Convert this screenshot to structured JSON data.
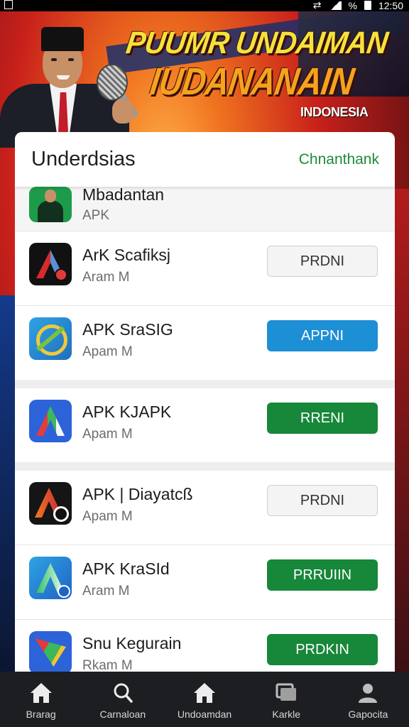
{
  "status_bar": {
    "time": "12:50",
    "battery_text": "%"
  },
  "banner": {
    "title_line1": "PUUMR UNDAIMAN",
    "title_line2": "IUDANANAIN",
    "subtitle": "INDONESIA"
  },
  "card": {
    "title": "Underdsias",
    "link": "Chnanthank"
  },
  "apps": [
    {
      "name": "Mbadantan",
      "sub": "APK",
      "button": "",
      "button_style": "none",
      "icon": "app-icon-person"
    },
    {
      "name": "ArK Scafiksj",
      "sub": "Aram M",
      "button": "PRDNI",
      "button_style": "gray",
      "icon": "app-icon-a-dark"
    },
    {
      "name": "APK SraSIG",
      "sub": "Apam M",
      "button": "APPNI",
      "button_style": "blue",
      "icon": "app-icon-ring"
    },
    {
      "name": "APK KJAPK",
      "sub": "Apam M",
      "button": "RRENI",
      "button_style": "green",
      "icon": "app-icon-a-blue"
    },
    {
      "name": "APK | Diayatcß",
      "sub": "Apam M",
      "button": "PRDNI",
      "button_style": "gray",
      "icon": "app-icon-a-orange"
    },
    {
      "name": "APK KraSId",
      "sub": "Aram M",
      "button": "PRRUIIN",
      "button_style": "green",
      "icon": "app-icon-a-green"
    },
    {
      "name": "Snu Kegurain",
      "sub": "Rkam M",
      "button": "PRDKIN",
      "button_style": "green",
      "icon": "app-icon-shape"
    }
  ],
  "nav": [
    {
      "label": "Brarag",
      "icon": "home-icon"
    },
    {
      "label": "Carnaloan",
      "icon": "search-icon"
    },
    {
      "label": "Undoamdan",
      "icon": "home-icon"
    },
    {
      "label": "Karkle",
      "icon": "library-icon"
    },
    {
      "label": "Gapocita",
      "icon": "profile-icon"
    }
  ],
  "colors": {
    "accent_green": "#17873a",
    "accent_blue": "#1d8fd5",
    "link_green": "#1e8b3a",
    "nav_bg": "#1d1e22"
  }
}
